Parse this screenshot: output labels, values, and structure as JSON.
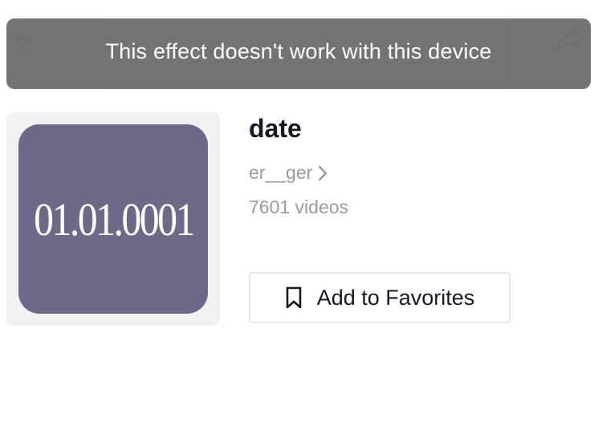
{
  "toast": {
    "message": "This effect doesn't work with this device"
  },
  "effect": {
    "thumbnail_text": "01.01.0001",
    "title": "date",
    "creator": "er__ger",
    "video_count": "7601 videos"
  },
  "actions": {
    "favorite_label": "Add to Favorites"
  },
  "icons": {
    "back": "arrow-left-icon",
    "share": "share-arrow-icon",
    "creator_link": "chevron-right-icon",
    "favorite": "bookmark-icon"
  },
  "colors": {
    "toast_bg": "#6f6f6f",
    "thumb_bg": "#6c6a88",
    "card_bg": "#f1f1f1",
    "title_text": "#161823",
    "secondary_text": "#9a9a9f"
  }
}
